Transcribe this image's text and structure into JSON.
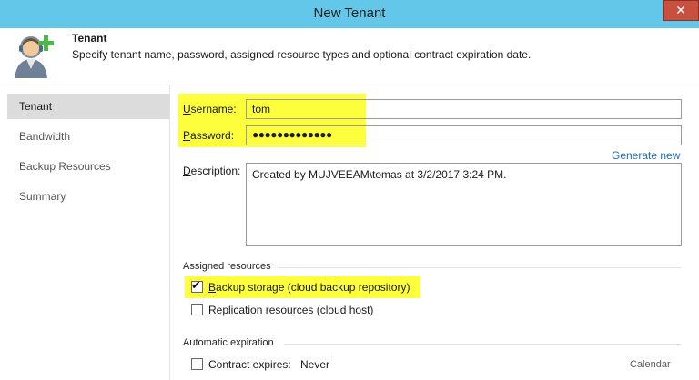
{
  "window": {
    "title": "New Tenant",
    "close_label": "✕"
  },
  "header": {
    "title": "Tenant",
    "subtitle": "Specify tenant name, password, assigned resource types and optional contract expiration date."
  },
  "sidebar": {
    "items": [
      {
        "label": "Tenant",
        "active": true
      },
      {
        "label": "Bandwidth"
      },
      {
        "label": "Backup Resources"
      },
      {
        "label": "Summary"
      }
    ]
  },
  "form": {
    "username_label_u": "U",
    "username_label_rest": "sername:",
    "username_value": "tom",
    "password_label_u": "P",
    "password_label_rest": "assword:",
    "password_value": "●●●●●●●●●●●●●",
    "generate_link": "Generate new",
    "description_label_u": "D",
    "description_label_rest": "escription:",
    "description_value": "Created by MUJVEEAM\\tomas at 3/2/2017 3:24 PM."
  },
  "assigned": {
    "section_label": "Assigned resources",
    "backup_storage_u": "B",
    "backup_storage_rest": "ackup storage (cloud backup repository)",
    "backup_storage_checked": true,
    "replication_u": "R",
    "replication_rest": "eplication resources (cloud host)",
    "replication_checked": false
  },
  "expiration": {
    "section_label": "Automatic expiration",
    "contract_label": "Contract expires:",
    "contract_value": "Never",
    "calendar_label": "Calendar"
  },
  "colors": {
    "titlebar": "#63c7ea",
    "highlight": "#fdff3c",
    "link": "#1d6fb8",
    "close": "#c7503f"
  },
  "icons": {
    "header_icon": "user-add-icon",
    "check_icon": "checkmark-icon"
  }
}
